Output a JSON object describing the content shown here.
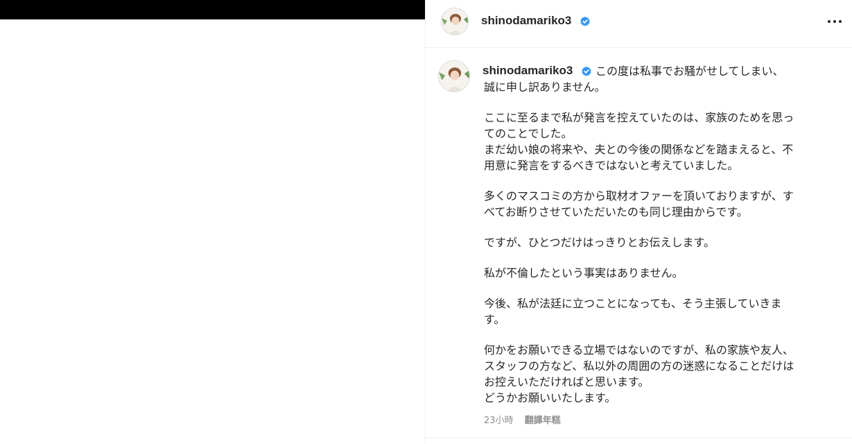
{
  "post": {
    "username": "shinodamariko3",
    "verified": true,
    "more_icon": "more-horizontal-icon"
  },
  "caption": {
    "first_line": "この度は私事でお騒がせしてしまい、",
    "lines": [
      "誠に申し訳ありません。",
      "",
      "ここに至るまで私が発言を控えていたのは、家族のためを思っ",
      "てのことでした。",
      "まだ幼い娘の将来や、夫との今後の関係などを踏まえると、不",
      "用意に発言をするべきではないと考えていました。",
      "",
      "多くのマスコミの方から取材オファーを頂いておりますが、す",
      "べてお断りさせていただいたのも同じ理由からです。",
      "",
      "ですが、ひとつだけはっきりとお伝えします。",
      "",
      "私が不倫したという事実はありません。",
      "",
      "今後、私が法廷に立つことになっても、そう主張していきま",
      "す。",
      "",
      "何かをお願いできる立場ではないのですが、私の家族や友人、",
      "スタッフの方など、私以外の周囲の方の迷惑になることだけは",
      "お控えいただければと思います。",
      "どうかお願いいたします。"
    ]
  },
  "meta": {
    "time_ago": "23小時",
    "translate_label": "翻譯年糕"
  },
  "colors": {
    "verified": "#3897f0",
    "text": "#262626",
    "muted": "#8e8e8e",
    "divider": "#efefef"
  }
}
